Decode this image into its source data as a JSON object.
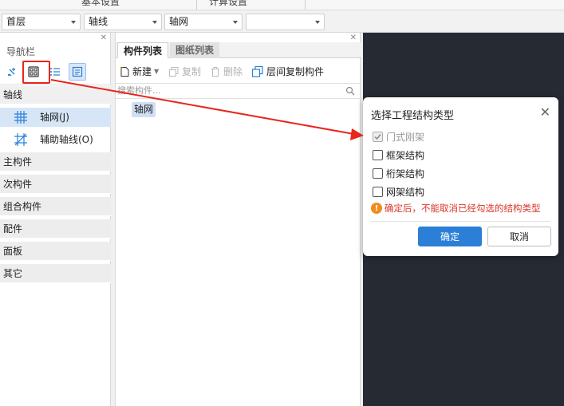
{
  "top_tabs": [
    "基本设置",
    "计算设置"
  ],
  "dropdowns": {
    "floor": "首层",
    "category": "轴线",
    "component_type": "轴网",
    "extra": ""
  },
  "nav": {
    "title": "导航栏",
    "group_axis": "轴线",
    "items": [
      {
        "label": "轴网(J)",
        "icon": "grid-icon",
        "selected": true
      },
      {
        "label": "辅助轴线(O)",
        "icon": "aux-axis-icon",
        "selected": false
      }
    ],
    "groups": [
      "主构件",
      "次构件",
      "组合构件",
      "配件",
      "面板",
      "其它"
    ]
  },
  "complist": {
    "tabs": [
      {
        "label": "构件列表",
        "active": true
      },
      {
        "label": "图纸列表",
        "active": false
      }
    ],
    "toolbar": {
      "new": "新建",
      "copy": "复制",
      "delete": "删除",
      "copy_between_floors": "层间复制构件"
    },
    "search_placeholder": "搜索构件...",
    "items": [
      "轴网"
    ]
  },
  "dialog": {
    "title": "选择工程结构类型",
    "options": [
      {
        "label": "门式刚架",
        "checked": true,
        "disabled": true
      },
      {
        "label": "框架结构",
        "checked": false,
        "disabled": false
      },
      {
        "label": "桁架结构",
        "checked": false,
        "disabled": false
      },
      {
        "label": "网架结构",
        "checked": false,
        "disabled": false
      }
    ],
    "warning": "确定后，不能取消已经勾选的结构类型",
    "ok": "确定",
    "cancel": "取消"
  },
  "colors": {
    "annotation_red": "#e8261d",
    "primary_blue": "#2b7fd6",
    "canvas_dark": "#262b33",
    "warning_text": "#d9362b"
  }
}
